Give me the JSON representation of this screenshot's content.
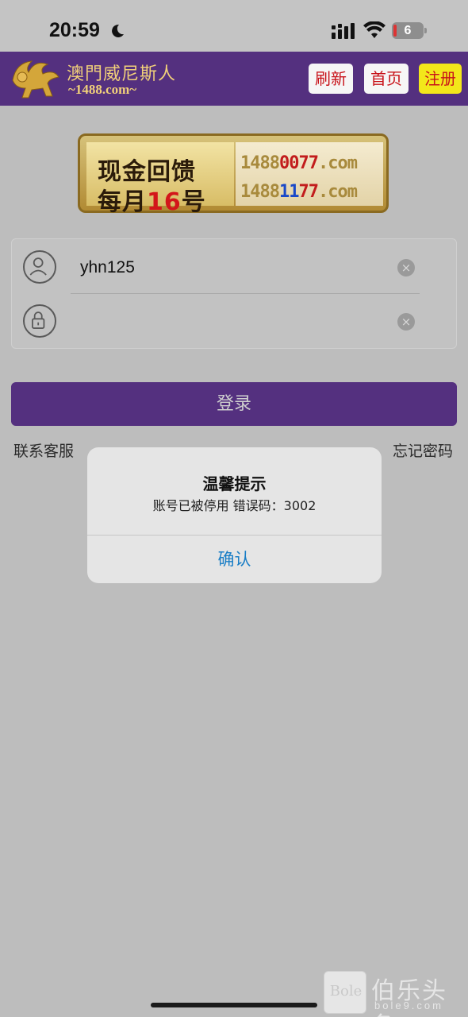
{
  "status_bar": {
    "time": "20:59",
    "battery_level": "6",
    "icons": [
      "moon-icon",
      "signal-icon",
      "wifi-icon",
      "battery-icon"
    ]
  },
  "header": {
    "logo_title": "澳門威尼斯人",
    "logo_domain": "~1488.com~",
    "buttons": {
      "refresh": "刷新",
      "home": "首页",
      "register": "注册"
    },
    "colors": {
      "background": "#54307f",
      "button_text": "#c8131a",
      "register_bg": "#f3e71a"
    }
  },
  "banner": {
    "line1": "现金回馈",
    "line2_prefix": "每月",
    "line2_highlight": "16",
    "line2_suffix": "号",
    "url1": {
      "a": "1488",
      "b": "00",
      "c": "77",
      "d": ".com"
    },
    "url2": {
      "a": "1488",
      "b": "11",
      "c": "77",
      "d": ".com"
    }
  },
  "login_form": {
    "username_value": "yhn125",
    "password_value": ""
  },
  "login_button": "登录",
  "links": {
    "support": "联系客服",
    "forgot_password": "忘记密码"
  },
  "alert": {
    "title": "温馨提示",
    "message": "账号已被停用 错误码：3002",
    "confirm": "确认",
    "confirm_color": "#1a7ec6"
  },
  "watermark": {
    "logo": "Bole",
    "name": "伯乐头条",
    "site": "bole9.com"
  }
}
